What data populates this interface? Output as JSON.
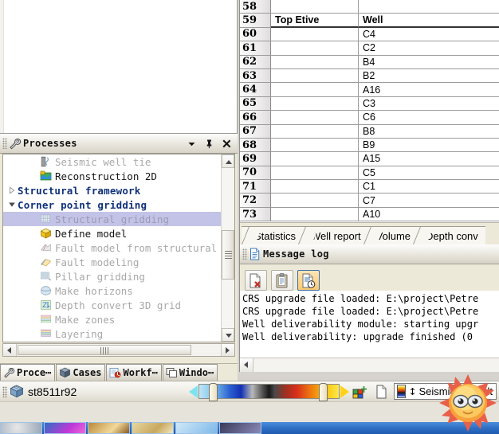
{
  "blank_panel": {
    "name": "empty-document-view"
  },
  "processes": {
    "title": "Processes",
    "title_icon": "wrench-icon",
    "buttons": [
      {
        "name": "panel-menu-button",
        "icon": "chevron-down-icon"
      },
      {
        "name": "panel-pin-button",
        "icon": "pin-icon"
      },
      {
        "name": "panel-close-button",
        "icon": "close-icon"
      }
    ],
    "tree": [
      {
        "label": "Seismic well tie",
        "icon": "seismic-well-tie-icon",
        "style": "dim",
        "indent": 2,
        "twisty": "none",
        "selected": false
      },
      {
        "label": "Reconstruction 2D",
        "icon": "reconstruction-2d-icon",
        "style": "dark",
        "indent": 2,
        "twisty": "none",
        "selected": false
      },
      {
        "label": "Structural framework",
        "icon": "none",
        "style": "group",
        "indent": 0,
        "twisty": "collapsed",
        "selected": false
      },
      {
        "label": "Corner point gridding",
        "icon": "none",
        "style": "group",
        "indent": 0,
        "twisty": "expanded",
        "selected": false
      },
      {
        "label": "Structural gridding",
        "icon": "grid-icon",
        "style": "dim",
        "indent": 2,
        "twisty": "none",
        "selected": true
      },
      {
        "label": "Define model",
        "icon": "yellow-cube-icon",
        "style": "dark",
        "indent": 2,
        "twisty": "none",
        "selected": false
      },
      {
        "label": "Fault model from structural",
        "icon": "fault-model-icon",
        "style": "dim",
        "indent": 2,
        "twisty": "none",
        "selected": false
      },
      {
        "label": "Fault modeling",
        "icon": "fault-modeling-icon",
        "style": "dim",
        "indent": 2,
        "twisty": "none",
        "selected": false
      },
      {
        "label": "Pillar gridding",
        "icon": "pillar-grid-icon",
        "style": "dim",
        "indent": 2,
        "twisty": "none",
        "selected": false
      },
      {
        "label": "Make horizons",
        "icon": "make-horizons-icon",
        "style": "dim",
        "indent": 2,
        "twisty": "none",
        "selected": false
      },
      {
        "label": "Depth convert 3D grid",
        "icon": "depth-convert-icon",
        "style": "dim",
        "indent": 2,
        "twisty": "none",
        "selected": false
      },
      {
        "label": "Make zones",
        "icon": "make-zones-icon",
        "style": "dim",
        "indent": 2,
        "twisty": "none",
        "selected": false
      },
      {
        "label": "Layering",
        "icon": "layering-icon",
        "style": "dim",
        "indent": 2,
        "twisty": "none",
        "selected": false
      }
    ]
  },
  "left_tabs": [
    {
      "label": "Proce⋯",
      "icon": "wrench-icon",
      "active": true
    },
    {
      "label": "Cases",
      "icon": "cases-icon",
      "active": false
    },
    {
      "label": "Workf⋯",
      "icon": "workflow-icon",
      "active": false
    },
    {
      "label": "Windo⋯",
      "icon": "windows-icon",
      "active": false
    }
  ],
  "spreadsheet": {
    "header_row_number": "59",
    "header_col1": "Top Etive",
    "header_col2": "Well",
    "rows": [
      {
        "n": "58",
        "c1": "",
        "c2": "",
        "header": false
      },
      {
        "n": "59",
        "c1": "Top Etive",
        "c2": "Well",
        "header": true
      },
      {
        "n": "60",
        "c1": "",
        "c2": "C4",
        "header": false
      },
      {
        "n": "61",
        "c1": "",
        "c2": "C2",
        "header": false
      },
      {
        "n": "62",
        "c1": "",
        "c2": "B4",
        "header": false
      },
      {
        "n": "63",
        "c1": "",
        "c2": "B2",
        "header": false
      },
      {
        "n": "64",
        "c1": "",
        "c2": "A16",
        "header": false
      },
      {
        "n": "65",
        "c1": "",
        "c2": "C3",
        "header": false
      },
      {
        "n": "66",
        "c1": "",
        "c2": "C6",
        "header": false
      },
      {
        "n": "67",
        "c1": "",
        "c2": "B8",
        "header": false
      },
      {
        "n": "68",
        "c1": "",
        "c2": "B9",
        "header": false
      },
      {
        "n": "69",
        "c1": "",
        "c2": "A15",
        "header": false
      },
      {
        "n": "70",
        "c1": "",
        "c2": "C5",
        "header": false
      },
      {
        "n": "71",
        "c1": "",
        "c2": "C1",
        "header": false
      },
      {
        "n": "72",
        "c1": "",
        "c2": "C7",
        "header": false
      },
      {
        "n": "73",
        "c1": "",
        "c2": "A10",
        "header": false
      }
    ]
  },
  "sheet_tabs": [
    {
      "label": "Statistics",
      "active": false
    },
    {
      "label": "Well report",
      "active": false
    },
    {
      "label": "Volume",
      "active": false
    },
    {
      "label": "Depth conv",
      "active": false
    }
  ],
  "message_log": {
    "title": "Message log",
    "title_icon": "document-icon",
    "toolbar": [
      {
        "name": "clear-log-button",
        "icon": "document-delete-icon",
        "active": false
      },
      {
        "name": "copy-log-button",
        "icon": "clipboard-icon",
        "active": false
      },
      {
        "name": "timestamp-log-button",
        "icon": "document-clock-icon",
        "active": true
      }
    ],
    "lines": [
      "CRS upgrade file loaded: E:\\project\\Petre",
      "CRS upgrade file loaded: E:\\project\\Petre",
      "Well deliverability module: starting upgr",
      "Well deliverability: upgrade finished (0"
    ]
  },
  "statusbar": {
    "project_icon": "blue-cube-icon",
    "project_name": "st8511r92",
    "color_template": "Seismic (default",
    "icons": [
      {
        "name": "color-table-icon"
      },
      {
        "name": "new-document-icon"
      }
    ],
    "colorbar": {
      "name": "seismic-color-bar"
    }
  },
  "taskbar": {
    "items": [
      {
        "name": "taskbar-item-1"
      },
      {
        "name": "taskbar-item-2"
      },
      {
        "name": "taskbar-item-3"
      },
      {
        "name": "taskbar-item-4"
      },
      {
        "name": "taskbar-item-5"
      },
      {
        "name": "taskbar-item-6"
      }
    ]
  },
  "overlay": {
    "name": "sun-emoticon",
    "glyph": "☀"
  },
  "colors": {
    "panel": "#ece9d8",
    "group_text": "#10327a",
    "selection": "#c3c3e8",
    "dim_text": "#a8a8a8",
    "taskbar_blue": "#2f6fc4",
    "accent_orange": "#f8c96f"
  }
}
